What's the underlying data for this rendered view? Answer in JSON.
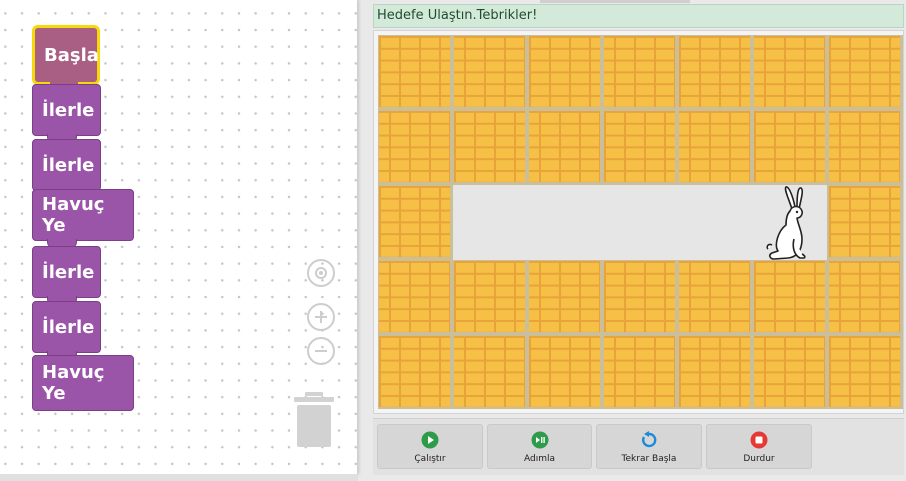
{
  "workspace": {
    "blocks": [
      {
        "label": "Başla",
        "kind": "start"
      },
      {
        "label": "İlerle",
        "kind": "move"
      },
      {
        "label": "İlerle",
        "kind": "move"
      },
      {
        "label": "Havuç Ye",
        "kind": "eat"
      },
      {
        "label": "İlerle",
        "kind": "move"
      },
      {
        "label": "İlerle",
        "kind": "move"
      },
      {
        "label": "Havuç Ye",
        "kind": "eat"
      }
    ],
    "controls": [
      "center-icon",
      "zoom-in-icon",
      "zoom-out-icon",
      "trash-icon"
    ]
  },
  "status": {
    "message": "Hedefe Ulaştın.Tebrikler!"
  },
  "stage": {
    "grid": {
      "rows": 5,
      "cols": 7
    },
    "path_row": 3,
    "path_cols": [
      2,
      6
    ],
    "character": "rabbit-icon",
    "character_cell": {
      "row": 3,
      "col": 6
    }
  },
  "buttons": [
    {
      "label": "Çalıştır",
      "icon": "play-icon",
      "color": "#2e9b4a"
    },
    {
      "label": "Adımla",
      "icon": "step-icon",
      "color": "#2e9b4a"
    },
    {
      "label": "Tekrar Başla",
      "icon": "restart-icon",
      "color": "#1a8bd9"
    },
    {
      "label": "Durdur",
      "icon": "stop-icon",
      "color": "#e53935"
    }
  ]
}
